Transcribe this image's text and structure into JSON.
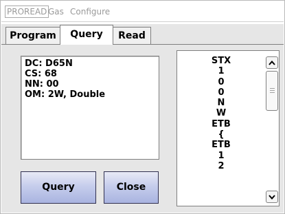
{
  "menu": {
    "items": [
      "PROREAD",
      "Gas",
      "Configure"
    ]
  },
  "tabs": [
    "Program",
    "Query",
    "Read"
  ],
  "active_tab": "Query",
  "info": {
    "lines": [
      "DC: D65N",
      "CS: 68",
      "NN: 00",
      "OM: 2W, Double"
    ]
  },
  "buttons": {
    "query_label": "Query",
    "close_label": "Close"
  },
  "response_list": {
    "items": [
      "STX",
      "1",
      "0",
      "0",
      "N",
      "W",
      "ETB",
      "{",
      "ETB",
      "1",
      "2"
    ]
  },
  "colors": {
    "button_gradient_top": "#e8eaf6",
    "button_gradient_bottom": "#a9b4e0",
    "panel_background": "#e6e6e6",
    "menu_text": "#9a9a9a"
  }
}
